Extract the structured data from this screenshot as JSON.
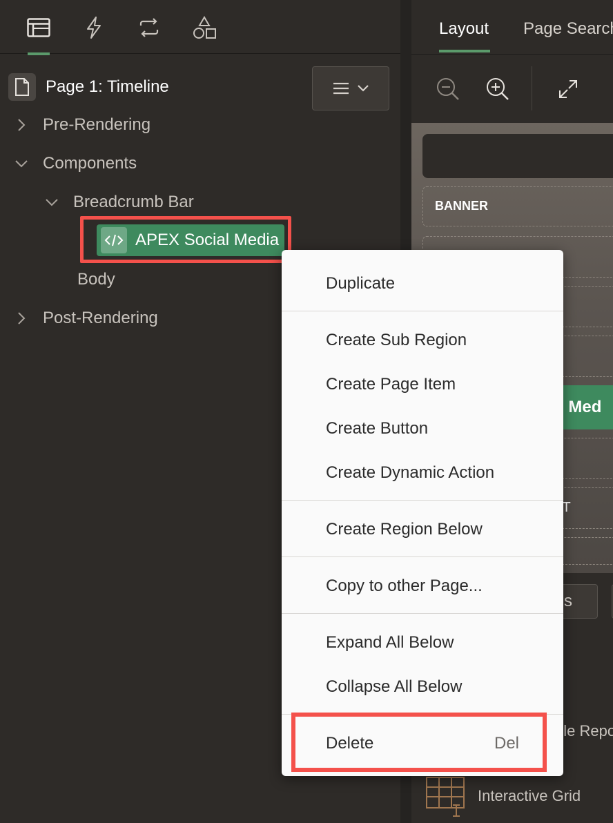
{
  "left_toolbar": {
    "tabs": [
      {
        "icon": "rendering-tree-icon",
        "active": true
      },
      {
        "icon": "dynamic-actions-icon",
        "active": false
      },
      {
        "icon": "processing-icon",
        "active": false
      },
      {
        "icon": "shared-components-icon",
        "active": false
      }
    ]
  },
  "tree": {
    "page_title": "Page 1: Timeline",
    "nodes": {
      "pre_rendering": "Pre-Rendering",
      "components": "Components",
      "breadcrumb_bar": "Breadcrumb Bar",
      "selected": "APEX Social Media",
      "body": "Body",
      "post_rendering": "Post-Rendering"
    }
  },
  "right_panel": {
    "tabs": [
      "Layout",
      "Page Search"
    ],
    "active_tab": "Layout",
    "banner_label": "BANNER",
    "selected_partial": "ial Med",
    "slot_partial": "NT",
    "button_partial": "ms",
    "gallery": {
      "item1_partial": "gle Repo",
      "item2": "Interactive Grid"
    }
  },
  "context_menu": {
    "items": {
      "duplicate": "Duplicate",
      "create_sub_region": "Create Sub Region",
      "create_page_item": "Create Page Item",
      "create_button": "Create Button",
      "create_dynamic_action": "Create Dynamic Action",
      "create_region_below": "Create Region Below",
      "copy_to_other_page": "Copy to other Page...",
      "expand_all_below": "Expand All Below",
      "collapse_all_below": "Collapse All Below",
      "delete": "Delete",
      "delete_shortcut": "Del"
    }
  },
  "colors": {
    "accent_green": "#3e8a5e",
    "highlight_red": "#f4514b",
    "panel_bg": "#2e2b28"
  }
}
